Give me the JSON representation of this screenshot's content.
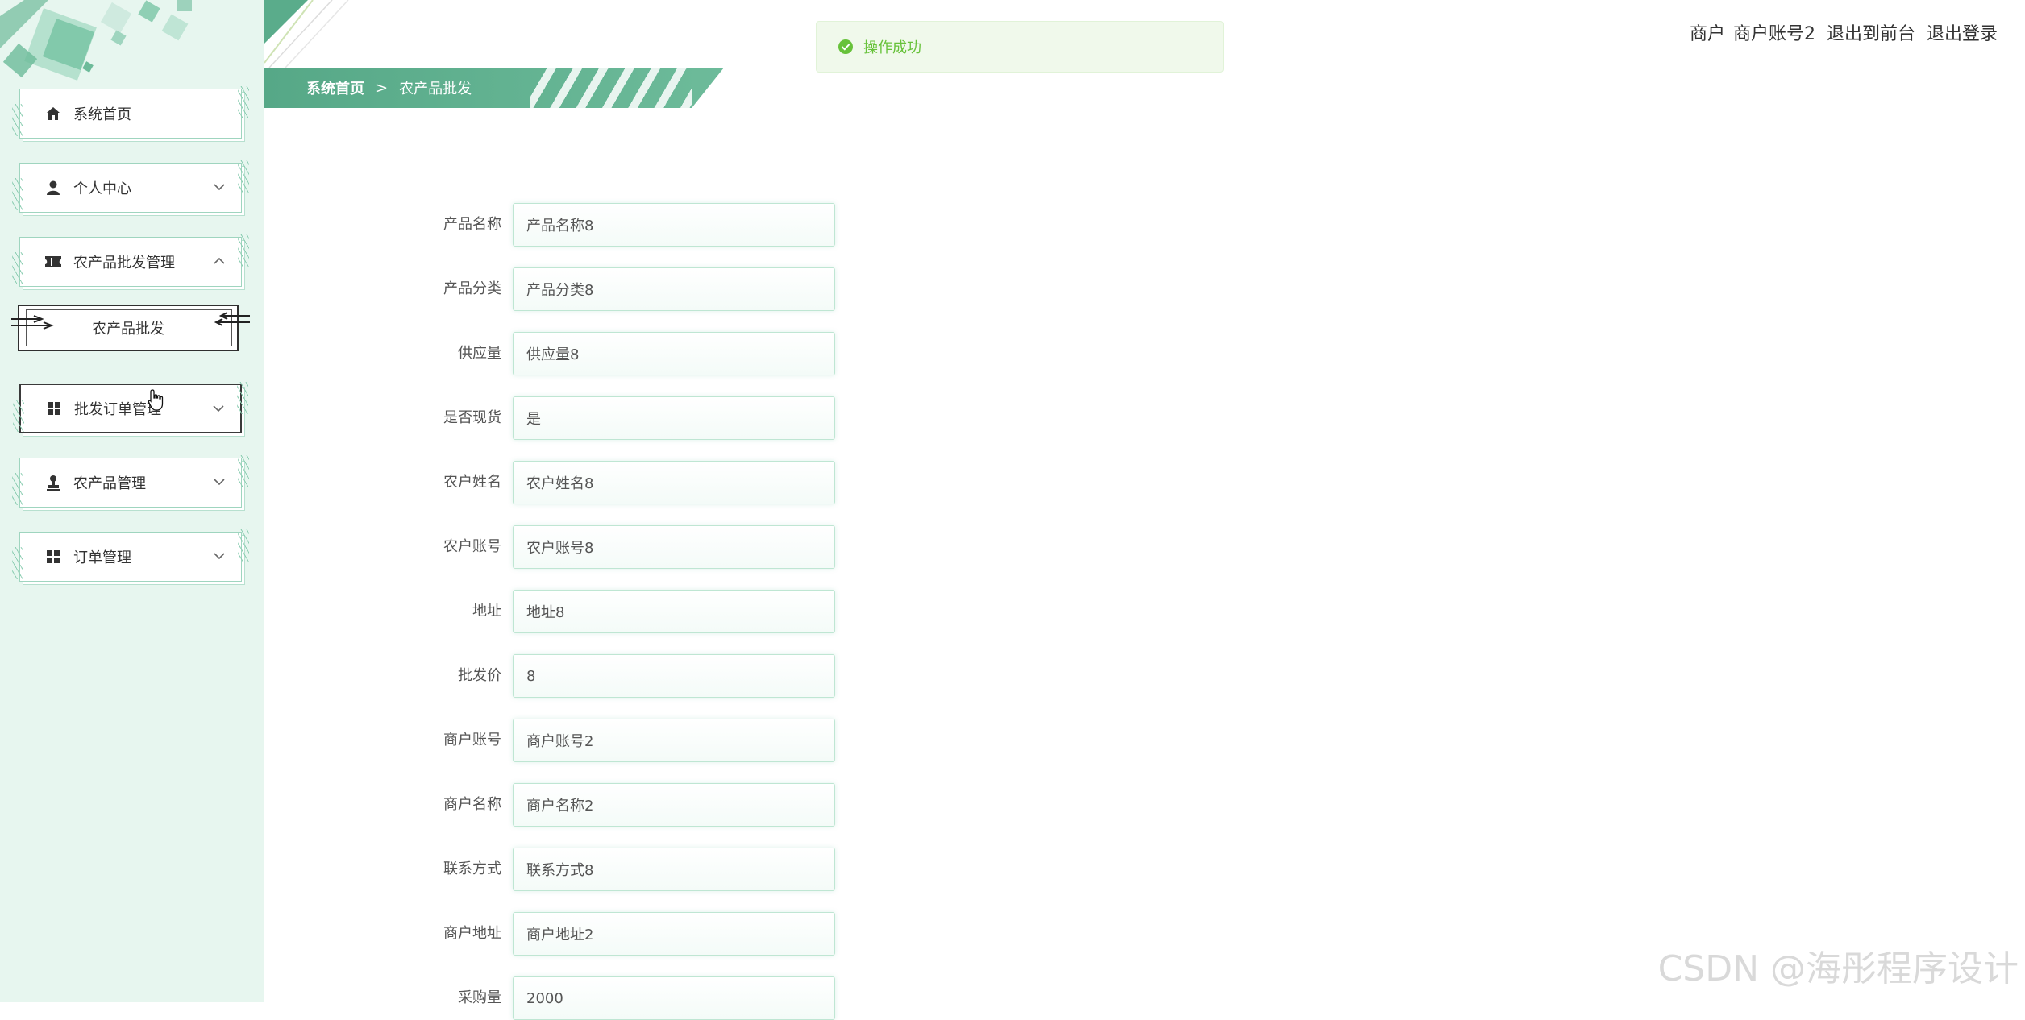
{
  "header": {
    "breadcrumb_home": "系统首页",
    "breadcrumb_sep": ">",
    "breadcrumb_current": "农产品批发",
    "user_role": "商户",
    "user_name": "商户账号2",
    "front_link": "退出到前台",
    "logout_link": "退出登录"
  },
  "toast": {
    "message": "操作成功"
  },
  "sidebar": {
    "items": [
      {
        "label": "系统首页",
        "icon": "home-icon"
      },
      {
        "label": "个人中心",
        "icon": "user-icon"
      },
      {
        "label": "农产品批发管理",
        "icon": "ticket-icon"
      },
      {
        "label": "批发订单管理",
        "icon": "grid-icon"
      },
      {
        "label": "农产品管理",
        "icon": "stamp-icon"
      },
      {
        "label": "订单管理",
        "icon": "grid-icon"
      }
    ],
    "submenu": {
      "label": "农产品批发"
    }
  },
  "form": {
    "fields": [
      {
        "label": "产品名称",
        "value": "产品名称8"
      },
      {
        "label": "产品分类",
        "value": "产品分类8"
      },
      {
        "label": "供应量",
        "value": "供应量8"
      },
      {
        "label": "是否现货",
        "value": "是"
      },
      {
        "label": "农户姓名",
        "value": "农户姓名8"
      },
      {
        "label": "农户账号",
        "value": "农户账号8"
      },
      {
        "label": "地址",
        "value": "地址8"
      },
      {
        "label": "批发价",
        "value": "8"
      },
      {
        "label": "商户账号",
        "value": "商户账号2"
      },
      {
        "label": "商户名称",
        "value": "商户名称2"
      },
      {
        "label": "联系方式",
        "value": "联系方式8"
      },
      {
        "label": "商户地址",
        "value": "商户地址2"
      },
      {
        "label": "采购量",
        "value": "2000"
      }
    ]
  },
  "watermark": "CSDN @海彤程序设计",
  "colors": {
    "primary": "#5aac8b",
    "sidebar_bg": "#e7f6ef",
    "success": "#67c23a"
  }
}
